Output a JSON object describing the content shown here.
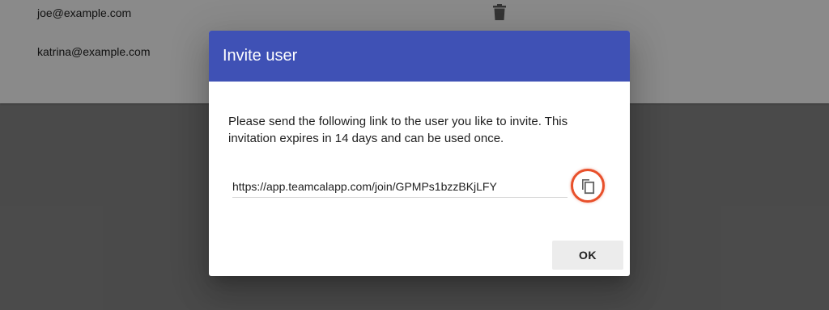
{
  "background": {
    "users": [
      {
        "email": "joe@example.com"
      },
      {
        "email": "katrina@example.com"
      }
    ],
    "delete_icon": "trash-icon"
  },
  "dialog": {
    "title": "Invite user",
    "message": "Please send the following link to the user you like to invite. This invitation expires in 14 days and can be used once.",
    "invite_link": "https://app.teamcalapp.com/join/GPMPs1bzzBKjLFY",
    "copy_icon": "copy-icon",
    "ok_label": "OK"
  },
  "colors": {
    "header": "#3f51b5",
    "highlight_ring": "#e8502b"
  }
}
